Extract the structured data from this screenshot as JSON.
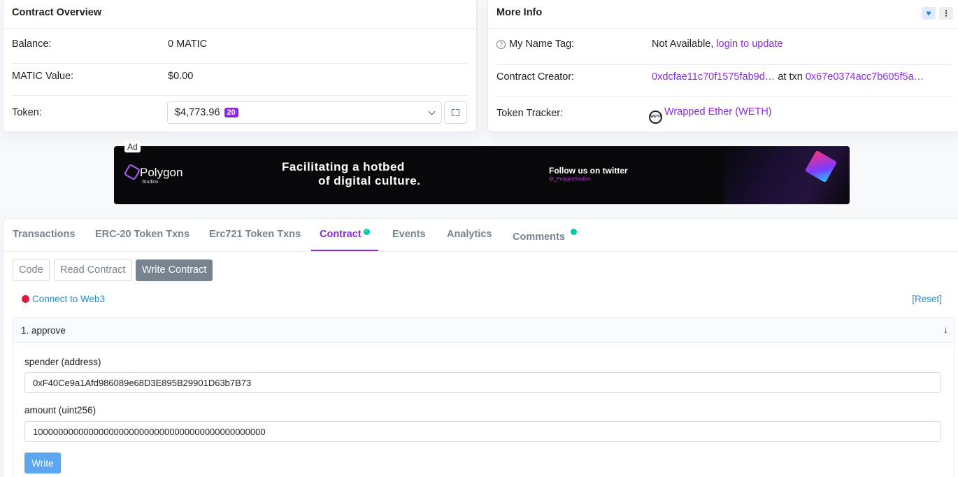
{
  "overview": {
    "title": "Contract Overview",
    "balance_label": "Balance:",
    "balance_value": "0 MATIC",
    "value_label": "MATIC Value:",
    "value_value": "$0.00",
    "token_label": "Token:",
    "token_value": "$4,773.96",
    "token_count": "20"
  },
  "more_info": {
    "title": "More Info",
    "name_tag_label": "My Name Tag:",
    "name_tag_value": "Not Available,",
    "name_tag_link": "login to update",
    "creator_label": "Contract Creator:",
    "creator_address": "0xdcfae11c70f1575fab9d…",
    "creator_at": "at txn",
    "creator_txn": "0x67e0374acc7b605f5a…",
    "tracker_label": "Token Tracker:",
    "tracker_value": "Wrapped Ether (WETH)",
    "tracker_icon_text": "WETH"
  },
  "ad": {
    "label": "Ad",
    "brand": "Polygon",
    "brand_sub": "Studios",
    "tagline_1": "Facilitating  a hotbed",
    "tagline_2": "of  digital culture.",
    "follow": "Follow us on twitter",
    "handle": "@_PolygonStudios"
  },
  "tabs": [
    {
      "label": "Transactions"
    },
    {
      "label": "ERC-20 Token Txns"
    },
    {
      "label": "Erc721 Token Txns"
    },
    {
      "label": "Contract"
    },
    {
      "label": "Events"
    },
    {
      "label": "Analytics"
    },
    {
      "label": "Comments"
    }
  ],
  "subtabs": [
    {
      "label": "Code"
    },
    {
      "label": "Read Contract"
    },
    {
      "label": "Write Contract"
    }
  ],
  "connect_label": "Connect to Web3",
  "reset_label": "[Reset]",
  "function": {
    "title": "1. approve",
    "spender_label": "spender (address)",
    "spender_value": "0xF40Ce9a1Afd986089e68D3E895B29901D63b7B73",
    "amount_label": "amount (uint256)",
    "amount_value": "1000000000000000000000000000000000000000000000",
    "write_label": "Write"
  },
  "colors": {
    "accent": "#8a2be2",
    "link_blue": "#1a8ddb",
    "write_button": "#5ca5ef",
    "status_red": "#de1a3a",
    "verified_green": "#00c9a7"
  }
}
